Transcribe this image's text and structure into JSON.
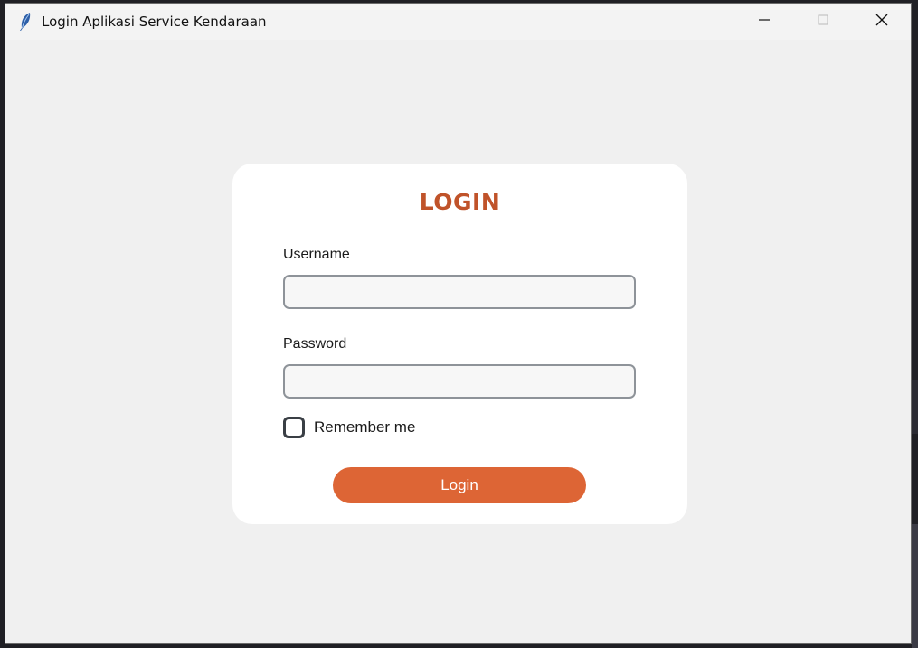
{
  "window": {
    "title": "Login Aplikasi Service Kendaraan",
    "icon": "feather-icon",
    "controls": [
      "minimize-icon",
      "maximize-icon",
      "close-icon"
    ]
  },
  "login_card": {
    "title": "LOGIN",
    "username": {
      "label": "Username",
      "value": "",
      "placeholder": ""
    },
    "password": {
      "label": "Password",
      "value": "",
      "placeholder": ""
    },
    "remember_me": {
      "label": "Remember me",
      "checked": false
    },
    "login_button": "Login"
  },
  "colors": {
    "accent": "#dd6535",
    "title": "#c0532a",
    "background": "#f0f0f0",
    "card": "#ffffff"
  }
}
